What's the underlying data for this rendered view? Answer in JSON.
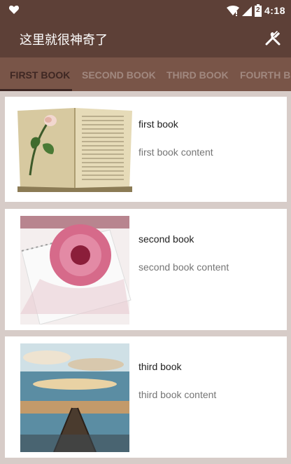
{
  "status_bar": {
    "time": "4:18",
    "battery_level": "2",
    "icons": [
      "heart-icon",
      "wifi-icon",
      "signal-icon",
      "battery-icon"
    ]
  },
  "app_bar": {
    "title": "这里就很神奇了",
    "action_icon": "fork-knife-icon"
  },
  "tabs": [
    {
      "label": "FIRST BOOK",
      "selected": true
    },
    {
      "label": "SECOND BOOK",
      "selected": false
    },
    {
      "label": "THIRD BOOK",
      "selected": false
    },
    {
      "label": "FOURTH BOOK",
      "selected": false
    }
  ],
  "books": [
    {
      "title": "first book",
      "content": "first book content"
    },
    {
      "title": "second book",
      "content": "second book content"
    },
    {
      "title": "third book",
      "content": "third book content"
    }
  ],
  "colors": {
    "primary": "#5d4037",
    "tab_bar": "#795548",
    "tab_active": "#3e2723",
    "tab_inactive": "#a1887f",
    "background": "#d7ccc8"
  }
}
